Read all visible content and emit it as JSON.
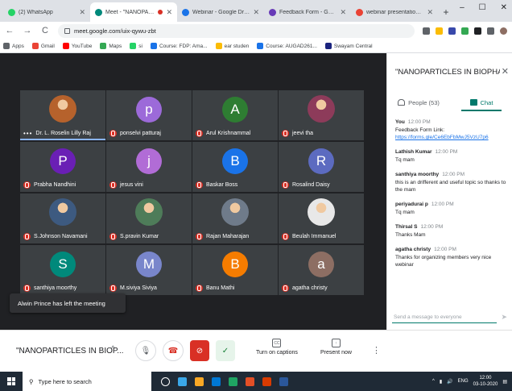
{
  "browser": {
    "tabs": [
      {
        "title": "(2) WhatsApp",
        "color": "#25d366",
        "active": false
      },
      {
        "title": "Meet - \"NANOPARTICLES",
        "color": "#00897b",
        "active": true,
        "recording": true
      },
      {
        "title": "Webinar - Google Drive",
        "color": "#1a73e8",
        "active": false
      },
      {
        "title": "Feedback Form - Google Form",
        "color": "#673ab7",
        "active": false
      },
      {
        "title": "webinar presentation - jvthall",
        "color": "#ea4335",
        "active": false
      }
    ],
    "new_tab": "+",
    "window_controls": [
      "–",
      "☐",
      "✕"
    ],
    "url": "meet.google.com/uix-qywu-zbt",
    "bookmarks": [
      {
        "label": "Apps",
        "color": "#5f6368"
      },
      {
        "label": "Gmail",
        "color": "#ea4335"
      },
      {
        "label": "YouTube",
        "color": "#ff0000"
      },
      {
        "label": "Maps",
        "color": "#34a853"
      },
      {
        "label": "si",
        "color": "#25d366"
      },
      {
        "label": "Course: FDP: Ama...",
        "color": "#1a73e8"
      },
      {
        "label": "ear studen",
        "color": "#fbbc04"
      },
      {
        "label": "Course: AUGAD261...",
        "color": "#1a73e8"
      },
      {
        "label": "Swayam Central",
        "color": "#1a237e"
      }
    ]
  },
  "meet": {
    "participants": [
      {
        "name": "Dr. L. Roselin Lilly Raj",
        "type": "photo",
        "photo_color": "#b6622c",
        "speaking": true
      },
      {
        "name": "ponselvi patturaj",
        "type": "letter",
        "letter": "p",
        "color": "#9c6ad9"
      },
      {
        "name": "Arul Krishnammal",
        "type": "letter",
        "letter": "A",
        "color": "#2e7d32"
      },
      {
        "name": "jeevi tha",
        "type": "photo",
        "photo_color": "#8d3b5a"
      },
      {
        "name": "Prabha Nandhini",
        "type": "letter",
        "letter": "P",
        "color": "#6a1fb5"
      },
      {
        "name": "jesus vini",
        "type": "letter",
        "letter": "j",
        "color": "#b16cd6"
      },
      {
        "name": "Baskar Boss",
        "type": "letter",
        "letter": "B",
        "color": "#1a73e8"
      },
      {
        "name": "Rosalind Daisy",
        "type": "letter",
        "letter": "R",
        "color": "#5c6bc0"
      },
      {
        "name": "S.Johnson Navamani",
        "type": "photo",
        "photo_color": "#3d5a80"
      },
      {
        "name": "S.pravin Kumar",
        "type": "photo",
        "photo_color": "#4e7c59"
      },
      {
        "name": "Rajan Maharajan",
        "type": "photo",
        "photo_color": "#6f7b8a"
      },
      {
        "name": "Beulah Immanuel",
        "type": "photo",
        "photo_color": "#e8e8e8"
      },
      {
        "name": "santhiya moorthy",
        "type": "letter",
        "letter": "S",
        "color": "#00897b"
      },
      {
        "name": "M.siviya Siviya",
        "type": "letter",
        "letter": "M",
        "color": "#7986cb"
      },
      {
        "name": "Banu Mathi",
        "type": "letter",
        "letter": "B",
        "color": "#f57c00"
      },
      {
        "name": "agatha christy",
        "type": "letter",
        "letter": "a",
        "color": "#8d6e63"
      }
    ],
    "toast": "Alwin Prince has left the meeting",
    "meeting_title": "\"NANOPARTICLES IN BIOP...",
    "controls": {
      "captions_label": "Turn on captions",
      "present_label": "Present now"
    }
  },
  "panel": {
    "title": "\"NANOPARTICLES IN BIOPHARM...",
    "people_tab": "People (53)",
    "chat_tab": "Chat",
    "messages": [
      {
        "sender": "You",
        "time": "12:00 PM",
        "lines": [
          "Feedback Form Link:"
        ],
        "link": "https://forms.gle/Ce6EbFbMwJ5VzU7p6"
      },
      {
        "sender": "Lathish Kumar",
        "time": "12:00 PM",
        "lines": [
          "Tq mam"
        ]
      },
      {
        "sender": "santhiya moorthy",
        "time": "12:00 PM",
        "lines": [
          "this is an drifferent and useful topic so thanks to the mam"
        ]
      },
      {
        "sender": "periyadurai p",
        "time": "12:00 PM",
        "lines": [
          "Tq mam"
        ]
      },
      {
        "sender": "Thirsal S",
        "time": "12:00 PM",
        "lines": [
          "Thanks Mam"
        ]
      },
      {
        "sender": "agatha christy",
        "time": "12:00 PM",
        "lines": [
          "Thanks for organizing members very nice webinar"
        ]
      }
    ],
    "input_placeholder": "Send a message to everyone"
  },
  "taskbar": {
    "search_placeholder": "Type here to search",
    "apps": [
      "#ffffff",
      "#3aa7e8",
      "#f9a825",
      "#0078d4",
      "#1fa463",
      "#e34f26",
      "#d83b01",
      "#2b579a"
    ],
    "tray_text": "ENG",
    "time": "12:00",
    "date": "03-10-2020"
  }
}
